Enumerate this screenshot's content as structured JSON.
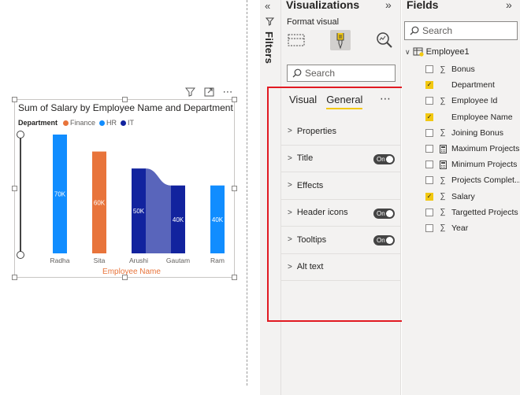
{
  "chart": {
    "title": "Sum of Salary by Employee Name and Department",
    "legend_title": "Department",
    "legend": [
      {
        "name": "Finance",
        "color": "#e8743b"
      },
      {
        "name": "HR",
        "color": "#118dff"
      },
      {
        "name": "IT",
        "color": "#12239e"
      }
    ],
    "xlabel": "Employee Name"
  },
  "chart_data": {
    "type": "bar",
    "title": "Sum of Salary by Employee Name and Department",
    "xlabel": "Employee Name",
    "ylabel": "",
    "categories": [
      "Radha",
      "Sita",
      "Arushi",
      "Gautam",
      "Ram"
    ],
    "series": [
      {
        "name": "Finance",
        "values": [
          null,
          60000,
          null,
          null,
          null
        ]
      },
      {
        "name": "HR",
        "values": [
          70000,
          null,
          null,
          null,
          40000
        ]
      },
      {
        "name": "IT",
        "values": [
          null,
          null,
          50000,
          40000,
          null
        ]
      }
    ],
    "data_labels": [
      "70K",
      "60K",
      "50K",
      "40K",
      "40K"
    ],
    "ylim": [
      0,
      70000
    ],
    "grid": false,
    "legend_position": "top-left",
    "chart_subtype": "ribbon"
  },
  "filters": {
    "label": "Filters"
  },
  "visualizations": {
    "title": "Visualizations",
    "format_label": "Format visual",
    "search_placeholder": "Search",
    "tabs": [
      "Visual",
      "General"
    ],
    "active_tab": "General",
    "sections": [
      {
        "label": "Properties",
        "toggle": null
      },
      {
        "label": "Title",
        "toggle": "On"
      },
      {
        "label": "Effects",
        "toggle": null
      },
      {
        "label": "Header icons",
        "toggle": "On"
      },
      {
        "label": "Tooltips",
        "toggle": "On"
      },
      {
        "label": "Alt text",
        "toggle": null
      }
    ]
  },
  "fields": {
    "title": "Fields",
    "search_placeholder": "Search",
    "table_name": "Employee1",
    "items": [
      {
        "label": "Bonus",
        "checked": false,
        "type": "sigma"
      },
      {
        "label": "Department",
        "checked": true,
        "type": "none"
      },
      {
        "label": "Employee Id",
        "checked": false,
        "type": "sigma"
      },
      {
        "label": "Employee Name",
        "checked": true,
        "type": "none"
      },
      {
        "label": "Joining Bonus",
        "checked": false,
        "type": "sigma"
      },
      {
        "label": "Maximum Projects",
        "checked": false,
        "type": "calc"
      },
      {
        "label": "Minimum Projects",
        "checked": false,
        "type": "calc"
      },
      {
        "label": "Projects Complet...",
        "checked": false,
        "type": "sigma"
      },
      {
        "label": "Salary",
        "checked": true,
        "type": "sigma"
      },
      {
        "label": "Targetted Projects",
        "checked": false,
        "type": "sigma"
      },
      {
        "label": "Year",
        "checked": false,
        "type": "sigma"
      }
    ]
  },
  "colors": {
    "accent": "#f2c811",
    "highlight_box": "#e11a22"
  }
}
